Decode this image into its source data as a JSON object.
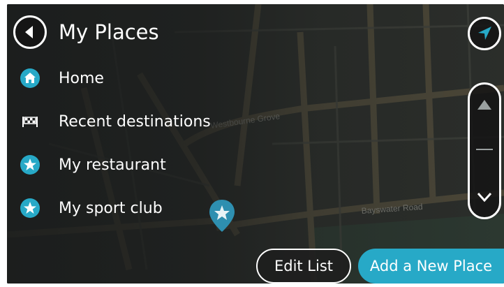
{
  "header": {
    "back_icon": "arrow-left-icon",
    "title": "My Places",
    "nav_icon": "navigation-arrow-icon"
  },
  "list": {
    "items": [
      {
        "label": "Home",
        "icon": "home-icon"
      },
      {
        "label": "Recent destinations",
        "icon": "checkered-flag-icon"
      },
      {
        "label": "My restaurant",
        "icon": "star-icon"
      },
      {
        "label": "My sport club",
        "icon": "star-icon"
      }
    ]
  },
  "scrollbar": {
    "up_icon": "chevron-up-icon",
    "down_icon": "chevron-down-icon"
  },
  "map": {
    "street_labels": [
      "Westbourne Grove",
      "Bayswater Road"
    ],
    "pin_icon": "star-map-pin-icon"
  },
  "actions": {
    "edit_label": "Edit List",
    "add_label": "Add a New Place"
  },
  "colors": {
    "accent": "#27a9c7",
    "background": "#2b2e2b",
    "text": "#ffffff"
  }
}
